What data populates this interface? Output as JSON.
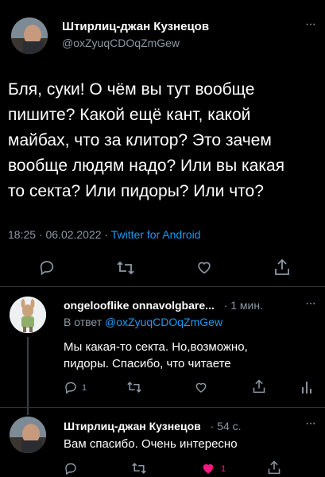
{
  "main_tweet": {
    "author_name": "Штирлиц-джан Кузнецов",
    "handle": "@oxZyuqCDOqZmGew",
    "text_lines": [
      "Бля, суки! О чём вы тут вообще",
      "пишите? Какой ещё кант, какой",
      "майбах, что за клитор? Это зачем",
      "вообще людям надо? Или вы какая",
      "то секта? Или пидоры? Или что?"
    ],
    "time": "18:25 · 06.02.2022 · ",
    "source": "Twitter for Android"
  },
  "reply1": {
    "author_name": "ongelooflike onnavolgbare...",
    "time": "· 1 мин.",
    "reply_prefix": "В ответ ",
    "reply_handle": "@oxZyuqCDOqZmGew",
    "text_lines": [
      "Мы какая-то секта. Но,возможно,",
      "пидоры. Спасибо, что читаете"
    ],
    "reply_count": "1"
  },
  "reply2": {
    "author_name": "Штирлиц-джан Кузнецов",
    "time": "· 54 с.",
    "text": "Вам спасибо. Очень интересно",
    "like_count": "1"
  },
  "more_label": "···",
  "colors": {
    "background": "#000000",
    "link": "#1d9bf0",
    "muted": "#8b98a5",
    "like": "#f91880"
  },
  "icons": [
    "reply-icon",
    "retweet-icon",
    "like-icon",
    "share-icon",
    "analytics-icon",
    "more-icon"
  ]
}
